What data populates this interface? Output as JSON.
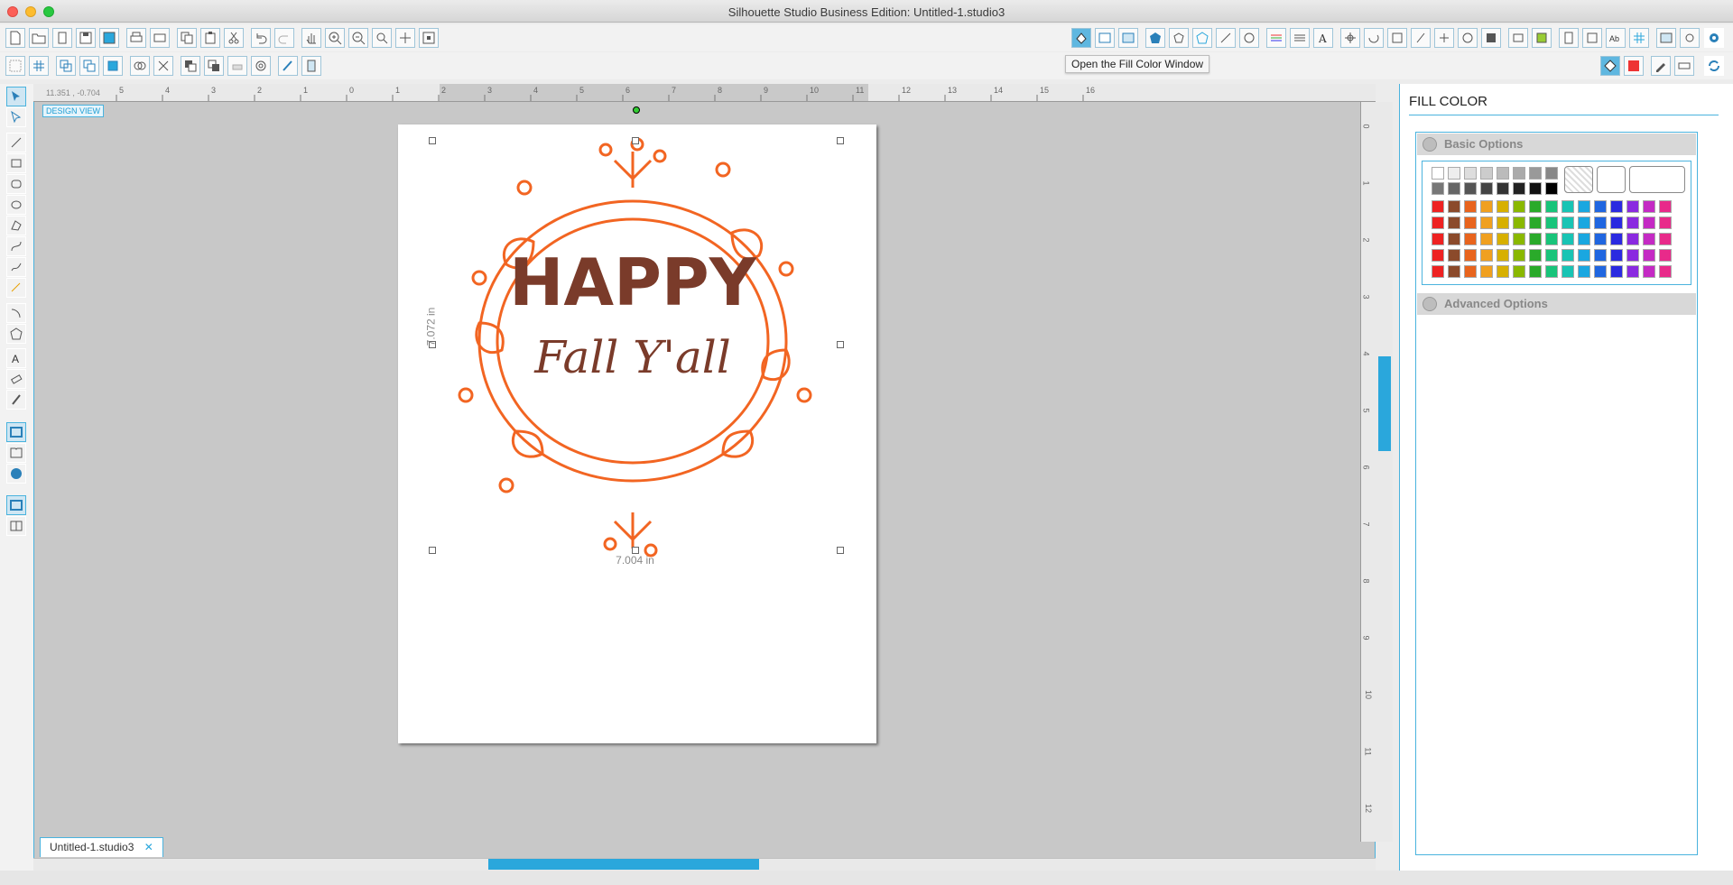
{
  "window": {
    "title": "Silhouette Studio Business Edition: Untitled-1.studio3"
  },
  "tooltip": "Open the Fill Color Window",
  "ruler": {
    "coordinates": "11.351 , -0.704",
    "h_ticks": [
      "5",
      "4",
      "3",
      "2",
      "1",
      "0",
      "1",
      "2",
      "3",
      "4",
      "5",
      "6",
      "7",
      "8",
      "9",
      "10",
      "11",
      "12",
      "13",
      "14",
      "15",
      "16"
    ],
    "v_ticks": [
      "0",
      "1",
      "2",
      "3",
      "4",
      "5",
      "6",
      "7",
      "8",
      "9",
      "10",
      "11",
      "12"
    ]
  },
  "design_view_label": "DESIGN VIEW",
  "artwork": {
    "line1": "HAPPY",
    "line2": "Fall Y'all",
    "width_label": "7.004 in",
    "height_label": "7.072 in"
  },
  "doc_tab": {
    "name": "Untitled-1.studio3"
  },
  "panel": {
    "title": "FILL COLOR",
    "basic_options": "Basic Options",
    "advanced_options": "Advanced Options"
  },
  "colors": {
    "accent": "#2aa7dc",
    "wreath": "#f26522",
    "text": "#7a3b2a"
  }
}
